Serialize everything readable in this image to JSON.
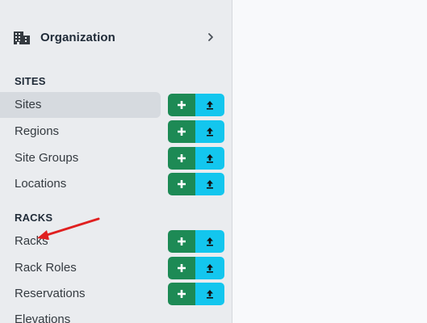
{
  "sidebar": {
    "org": {
      "label": "Organization",
      "icon": "building-icon",
      "chevron": "chevron-right-icon"
    },
    "sections": [
      {
        "title": "SITES",
        "items": [
          {
            "label": "Sites",
            "active": true,
            "actions": true
          },
          {
            "label": "Regions",
            "active": false,
            "actions": true
          },
          {
            "label": "Site Groups",
            "active": false,
            "actions": true
          },
          {
            "label": "Locations",
            "active": false,
            "actions": true
          }
        ]
      },
      {
        "title": "RACKS",
        "items": [
          {
            "label": "Racks",
            "active": false,
            "actions": true
          },
          {
            "label": "Rack Roles",
            "active": false,
            "actions": true
          },
          {
            "label": "Reservations",
            "active": false,
            "actions": true
          },
          {
            "label": "Elevations",
            "active": false,
            "actions": false
          }
        ]
      }
    ],
    "action_icons": {
      "add": "plus-icon",
      "import": "upload-icon"
    }
  },
  "colors": {
    "sidebar_bg": "#eaecef",
    "active_item_bg": "#d6dadf",
    "add_button": "#1d8a55",
    "import_button": "#13c6ee",
    "annotation_arrow": "#e02020"
  },
  "annotation": {
    "type": "arrow",
    "target": "Racks"
  }
}
